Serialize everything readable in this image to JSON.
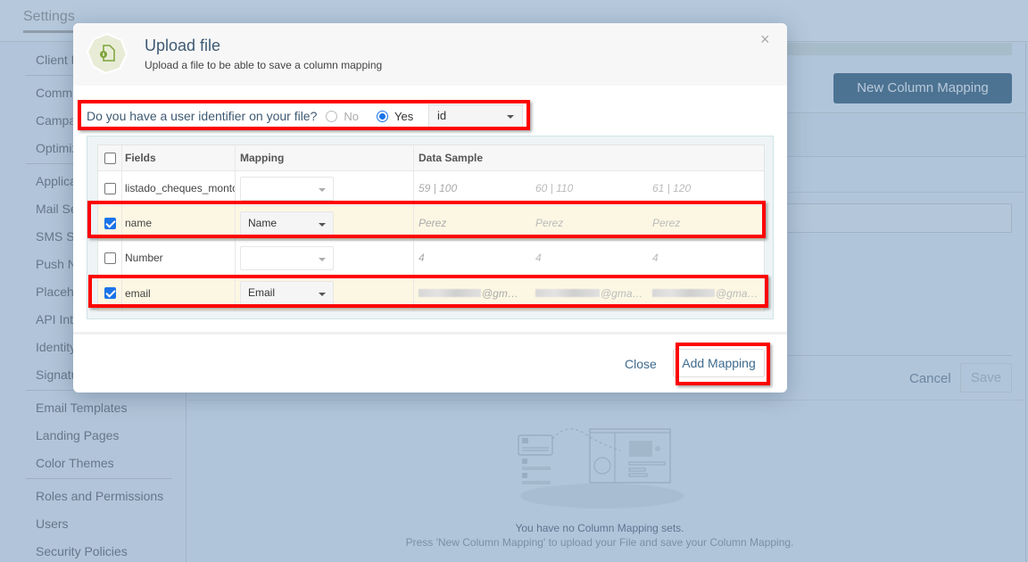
{
  "app": {
    "top_tab": "Settings"
  },
  "sidebar": {
    "items": [
      {
        "label": "Client M"
      },
      {
        "label": "Commu"
      },
      {
        "label": "Campa"
      },
      {
        "label": "Optimiz"
      },
      {
        "label": "Applica"
      },
      {
        "label": "Mail Se"
      },
      {
        "label": "SMS Se"
      },
      {
        "label": "Push N"
      },
      {
        "label": "Placeh"
      },
      {
        "label": "API Inte"
      },
      {
        "label": "Identity"
      },
      {
        "label": "Signatu"
      },
      {
        "label": "Email Templates"
      },
      {
        "label": "Landing Pages"
      },
      {
        "label": "Color Themes"
      },
      {
        "label": "Roles and Permissions"
      },
      {
        "label": "Users"
      },
      {
        "label": "Security Policies"
      }
    ]
  },
  "main": {
    "new_mapping_label": "New Column Mapping",
    "cancel_label": "Cancel",
    "save_label": "Save",
    "empty_title": "You have no Column Mapping sets.",
    "empty_subtitle": "Press 'New Column Mapping' to upload your File and save your Column Mapping."
  },
  "modal": {
    "title": "Upload file",
    "subtitle": "Upload a file to be able to save a column mapping",
    "close_icon": "×",
    "identifier_question": "Do you have a user identifier on your file?",
    "radio_no": "No",
    "radio_yes": "Yes",
    "identifier_selected": "yes",
    "identifier_field": "id",
    "table": {
      "headers": {
        "fields": "Fields",
        "mapping": "Mapping",
        "data_sample": "Data Sample"
      },
      "rows": [
        {
          "checked": false,
          "field": "listado_cheques_monto",
          "mapping": "",
          "samples": [
            "59 | 100",
            "60 | 110",
            "61 | 120"
          ]
        },
        {
          "checked": true,
          "field": "name",
          "mapping": "Name",
          "samples": [
            "Perez",
            "Perez",
            "Perez"
          ]
        },
        {
          "checked": false,
          "field": "Number",
          "mapping": "",
          "samples": [
            "4",
            "4",
            "4"
          ]
        },
        {
          "checked": true,
          "field": "email",
          "mapping": "Email",
          "samples": [
            "@gm…",
            "@gma…",
            "@gma…"
          ]
        }
      ]
    },
    "close_label": "Close",
    "add_label": "Add Mapping"
  },
  "colors": {
    "accent": "#3e6b8e",
    "checkbox": "#1a73e8",
    "highlight": "#ff0000",
    "selected_row": "#fcf7e3",
    "overlay": "#b1c5da"
  }
}
